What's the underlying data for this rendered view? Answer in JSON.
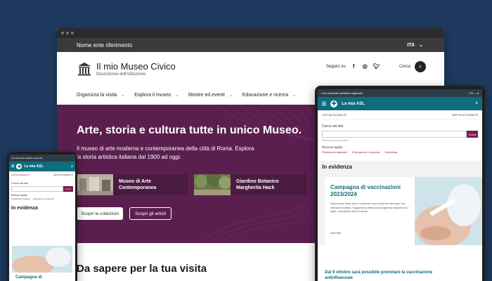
{
  "desktop": {
    "topbar": {
      "entity": "Nome ente riferimento",
      "lang": "ITA"
    },
    "header": {
      "title": "Il mio Museo Civico",
      "subtitle": "Descrizione dell'istituzione",
      "social_label": "Seguici su",
      "search_label": "Cerca"
    },
    "nav": [
      {
        "label": "Organizza la visita"
      },
      {
        "label": "Esplora il museo"
      },
      {
        "label": "Mostre ed eventi"
      },
      {
        "label": "Educazione e ricerca"
      }
    ],
    "hero": {
      "title": "Arte, storia e cultura tutte in unico Museo.",
      "text": "Il museo di arte moderna e contemporanea della città di Roma. Esplora la storia artistica italiana dal 1900 ad oggi.",
      "cards": [
        {
          "label": "Museo di Arte Contemporanea"
        },
        {
          "label": "Giardino Botanico Margherita Hack"
        }
      ],
      "btn_collections": "Scopri le collezioni",
      "btn_artists": "Scopri gli artisti"
    },
    "section_title": "Da sapere per la tua visita"
  },
  "tablet": {
    "top_text": "Link al portale sanitario regionale",
    "lang": "ITA",
    "brand": "La mia ASL",
    "cup": "CUP 06.2202304",
    "urp": "URP 06.07103269",
    "search_label": "Cerca nel sito",
    "search_btn": "Cerca",
    "hint": "Scrivi una parola chiave",
    "quick_label": "Ricerca rapida",
    "quick_links": [
      "Prestazioni sanitarie",
      "Emergenza e urgenza",
      "Screening"
    ],
    "evidence": "In evidenza",
    "card_title": "Campagna di vaccinazioni 2023/2024",
    "card_text": "Descrizione della card in evidenza, può contenere del testo che anticipa la notizia. Suggeriamo abbia una lunghezza massima di 3 righe, dopodiché viene troncato.",
    "card_more": "NOVIDE",
    "news": "Dal 9 ottobre sarà possibile prenotare la vaccinazione antinfluenzale"
  },
  "phone": {
    "top_text": "Link al portale sanitario regionale",
    "brand": "La mia ASL",
    "cup": "CUP 06.2202304",
    "urp": "URP 06.07103269",
    "search_label": "Cerca nel sito",
    "search_btn": "Cerca",
    "quick_label": "Ricerca rapida",
    "quick_links": [
      "Prestazioni sanitarie",
      "Emergenza e urgenza"
    ],
    "evidence": "In evidenza",
    "card_title": "Campagna di"
  },
  "colors": {
    "background": "#1e3a5f",
    "hero": "#5b1f4f",
    "asl_teal": "#0f6d7e",
    "accent": "#7a1f4f"
  },
  "icons": [
    "building-logo-icon",
    "facebook-icon",
    "instagram-icon",
    "twitter-icon",
    "search-icon",
    "chevron-down-icon",
    "hamburger-icon",
    "cross-logo-icon",
    "phone-icon",
    "user-icon"
  ]
}
